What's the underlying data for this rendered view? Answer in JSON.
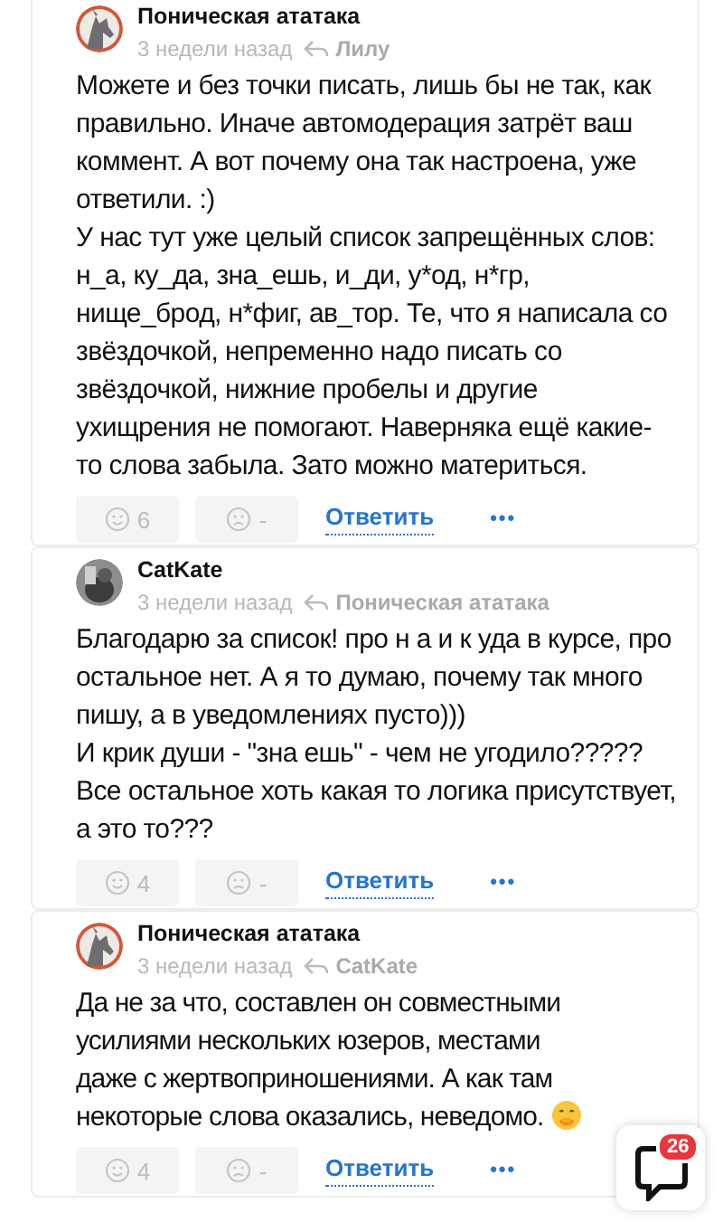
{
  "comments": [
    {
      "author": "Поническая ататака",
      "kind": "pony",
      "time": "3 недели назад",
      "reply_to": "Лилу",
      "paragraphs": [
        "Можете и без точки писать, лишь бы не так, как правильно. Иначе автомодерация затрёт ваш коммент. А вот почему она так настроена, уже ответили. :)",
        "У нас тут уже целый список запрещённых слов: н_а, ку_да, зна_ешь, и_ди, у*од, н*гр, нище_брод, н*фиг, ав_тор. Те, что я написала со звёздочкой, непременно надо писать со звёздочкой, нижние пробелы и другие ухищрения не помогают. Наверняка ещё какие-то слова забыла. Зато можно материться."
      ],
      "emoji": false,
      "likes": "6",
      "dislikes": "-",
      "reply": "Ответить",
      "more": "•••"
    },
    {
      "author": "CatKate",
      "time": "3 недели назад",
      "reply_to": "Поническая ататака",
      "paragraphs": [
        "Благодарю за список! про н а и к уда в курсе, про остальное нет. А я то думаю, почему так много пишу, а в уведомлениях пусто)))",
        "И крик души - \"зна ешь\" - чем не угодило????? Все остальное хоть какая то логика присутствует, а это то???"
      ],
      "emoji": false,
      "likes": "4",
      "dislikes": "-",
      "reply": "Ответить",
      "more": "•••"
    },
    {
      "author": "Поническая ататака",
      "kind": "pony",
      "time": "3 недели назад",
      "reply_to": "CatKate",
      "paragraphs": [
        "Да не за что, составлен он совместными усилиями нескольких юзеров, местами даже с жертвоприношениями. А как там некоторые слова оказались, неведомо."
      ],
      "emoji": true,
      "likes": "4",
      "dislikes": "-",
      "reply": "Ответить",
      "more": "•••"
    }
  ],
  "chat_button": {
    "badge": "26"
  }
}
